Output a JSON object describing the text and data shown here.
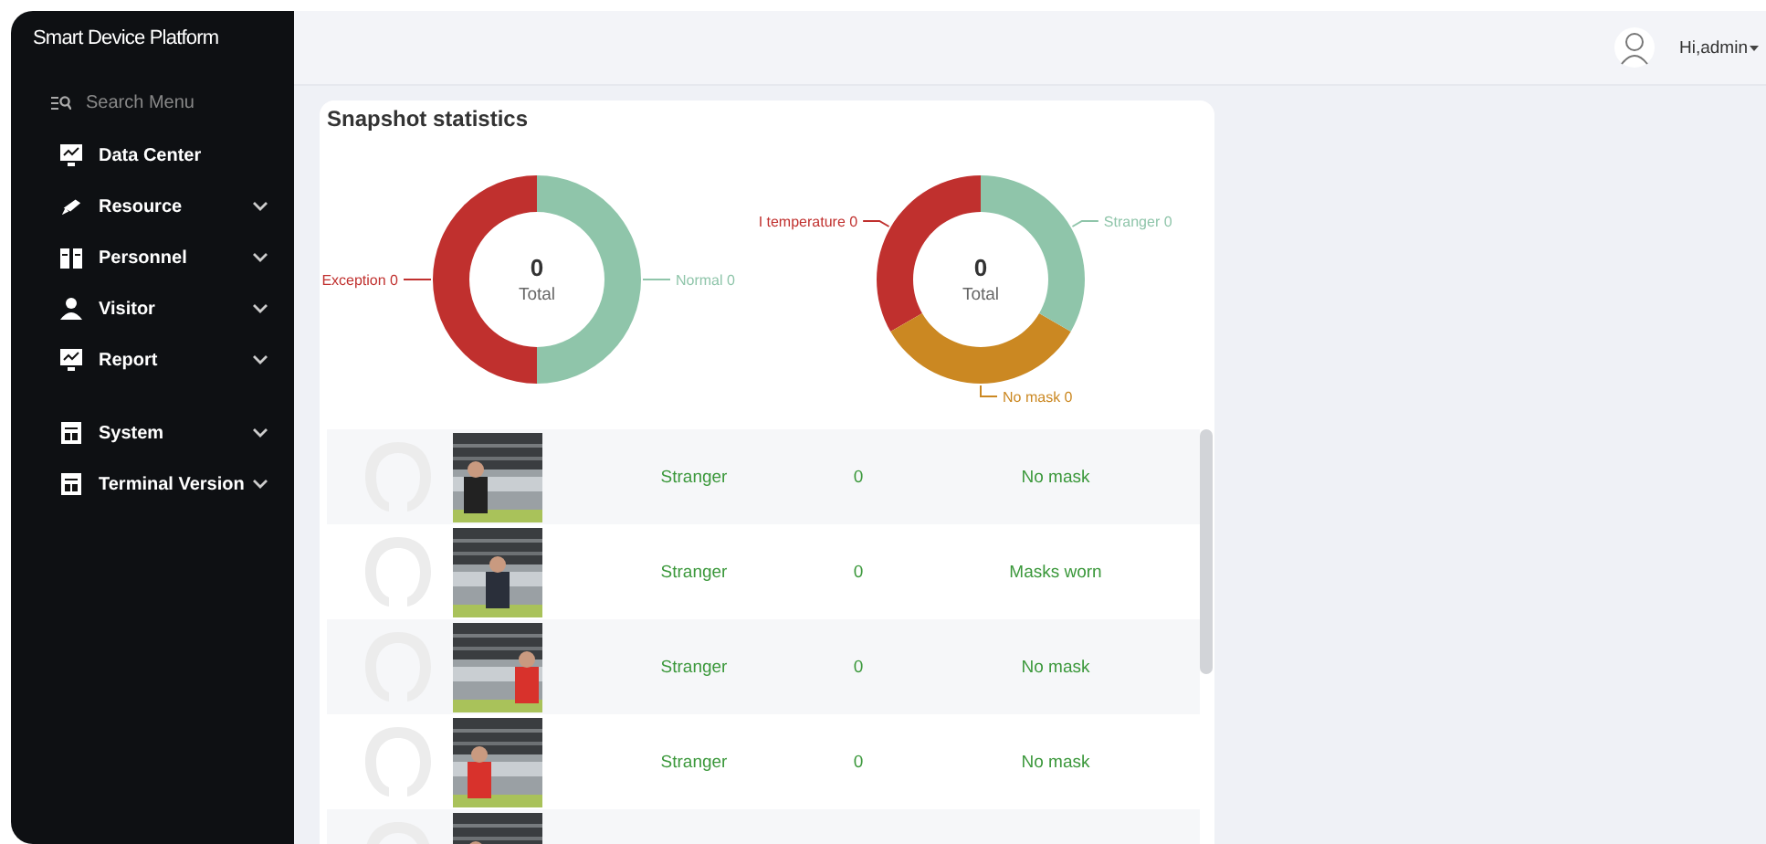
{
  "sidebar": {
    "title": "Smart Device Platform",
    "search": {
      "placeholder": "Search Menu"
    },
    "menu_groups": [
      [
        {
          "label": "Data Center",
          "expandable": false
        },
        {
          "label": "Resource",
          "expandable": true
        },
        {
          "label": "Personnel",
          "expandable": true
        },
        {
          "label": "Visitor",
          "expandable": true
        },
        {
          "label": "Report",
          "expandable": true
        }
      ],
      [
        {
          "label": "System",
          "expandable": true
        },
        {
          "label": "Terminal Version",
          "expandable": true
        }
      ]
    ]
  },
  "header": {
    "user": "Hi,admin"
  },
  "card": {
    "title": "Snapshot statistics",
    "charts": [
      {
        "total": "0",
        "total_label": "Total",
        "segments": [
          {
            "label": "Exception 0",
            "color": "#c0302e"
          },
          {
            "label": "Normal 0",
            "color": "#8fc5aa"
          }
        ]
      },
      {
        "total": "0",
        "total_label": "Total",
        "segments": [
          {
            "label": "I temperature 0",
            "color": "#c0302e"
          },
          {
            "label": "No mask 0",
            "color": "#cb8822"
          },
          {
            "label": "Stranger 0",
            "color": "#8fc5aa"
          }
        ]
      }
    ],
    "rows": [
      {
        "identity": "Stranger",
        "temperature": "0",
        "mask": "No mask"
      },
      {
        "identity": "Stranger",
        "temperature": "0",
        "mask": "Masks worn"
      },
      {
        "identity": "Stranger",
        "temperature": "0",
        "mask": "No mask"
      },
      {
        "identity": "Stranger",
        "temperature": "0",
        "mask": "No mask"
      },
      {}
    ]
  }
}
